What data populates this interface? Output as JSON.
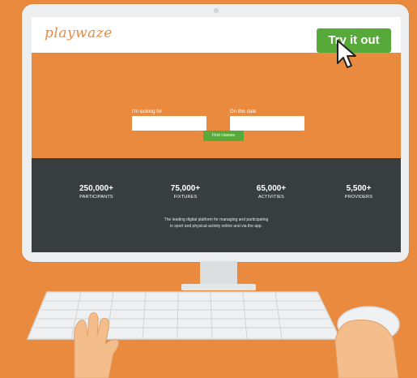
{
  "brand": {
    "logo_text": "playwaze"
  },
  "header": {
    "cta_label": "Try it out"
  },
  "search": {
    "looking_for_label": "I'm looking for",
    "date_label": "On this date",
    "looking_for_value": "",
    "date_value": "",
    "find_button_label": "Find classes"
  },
  "stats": [
    {
      "value": "250,000+",
      "label": "PARTICIPANTS"
    },
    {
      "value": "75,000+",
      "label": "FIXTURES"
    },
    {
      "value": "65,000+",
      "label": "ACTIVITIES"
    },
    {
      "value": "5,500+",
      "label": "PROVIDERS"
    }
  ],
  "tagline": {
    "line1": "The leading digital platform for managing and participating",
    "line2": "in sport and physical activity online and via the app."
  },
  "colors": {
    "background": "#e98a3f",
    "accent_green": "#57a939",
    "stats_band": "#383d3f",
    "monitor_frame": "#eceeef"
  },
  "icons": [
    "cursor-icon",
    "keyboard",
    "left-hand",
    "right-hand-on-mouse"
  ]
}
